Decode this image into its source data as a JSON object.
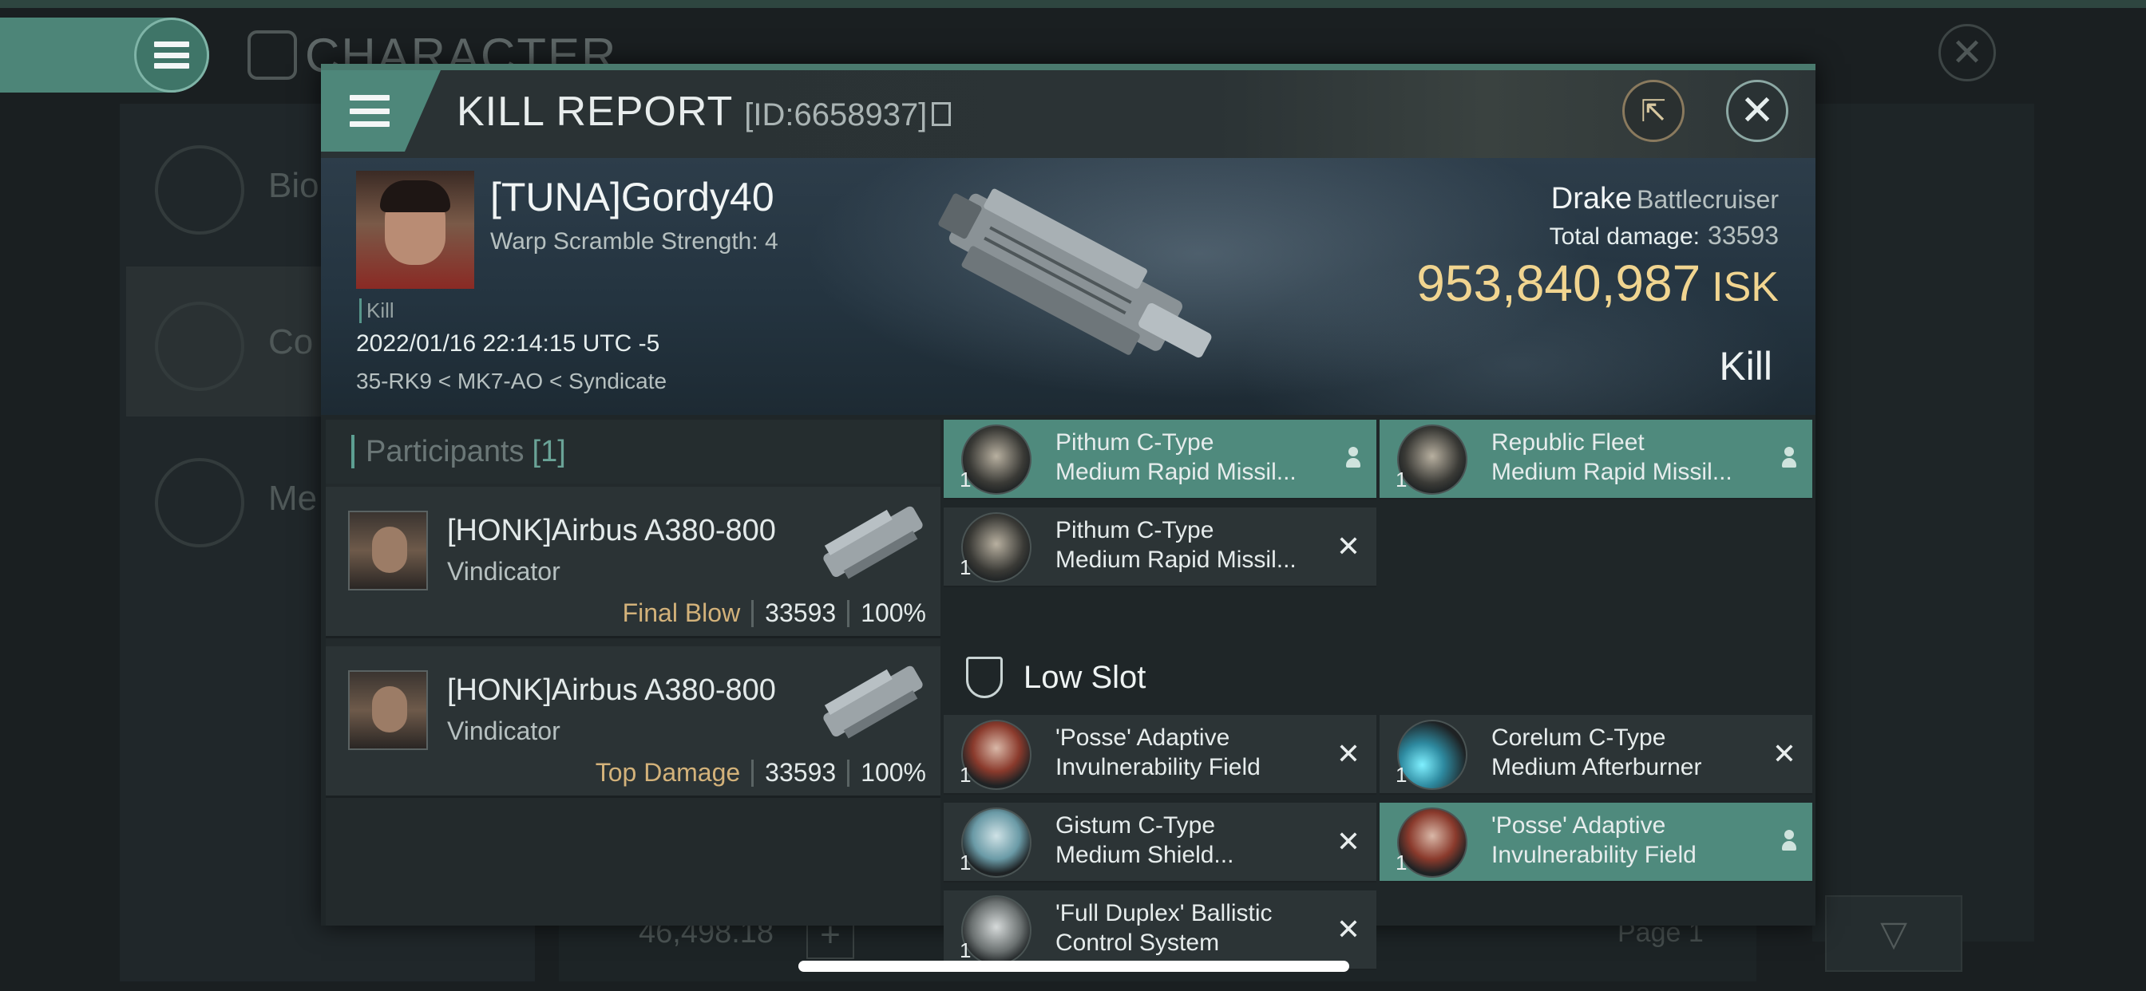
{
  "background": {
    "title": "CHARACTER",
    "tabs": [
      "Bio",
      "Co",
      "Me"
    ],
    "wallet_value": "46,498.18",
    "plus": "+",
    "page_label": "Page 1"
  },
  "kill_report": {
    "title": "KILL REPORT",
    "id_label": "[ID:6658937]",
    "victim": {
      "name": "[TUNA]Gordy40",
      "warp_scramble": "Warp Scramble Strength: 4",
      "kill_flag": "Kill",
      "timestamp": "2022/01/16 22:14:15 UTC -5",
      "location": "35-RK9 < MK7-AO < Syndicate"
    },
    "ship": {
      "name": "Drake",
      "class": "Battlecruiser",
      "total_damage_label": "Total damage:",
      "total_damage": "33593",
      "isk_value": "953,840,987",
      "isk_unit": "ISK",
      "result": "Kill"
    },
    "participants": {
      "label": "Participants",
      "count": "[1]",
      "rows": [
        {
          "name": "[HONK]Airbus A380-800",
          "ship": "Vindicator",
          "tag": "Final Blow",
          "damage": "33593",
          "percent": "100%"
        },
        {
          "name": "[HONK]Airbus A380-800",
          "ship": "Vindicator",
          "tag": "Top Damage",
          "damage": "33593",
          "percent": "100%"
        }
      ]
    },
    "modules": {
      "top": [
        {
          "line1": "Pithum C-Type",
          "line2": "Medium Rapid Missil...",
          "qty": "1",
          "status": "dropped",
          "icon": "launcher"
        },
        {
          "line1": "Republic Fleet",
          "line2": "Medium Rapid Missil...",
          "qty": "1",
          "status": "dropped",
          "icon": "launcher"
        },
        {
          "line1": "Pithum C-Type",
          "line2": "Medium Rapid Missil...",
          "qty": "1",
          "status": "destroyed",
          "icon": "launcher"
        }
      ],
      "low_slot_label": "Low Slot",
      "low": [
        {
          "line1": "'Posse' Adaptive",
          "line2": "Invulnerability Field",
          "qty": "1",
          "status": "destroyed",
          "icon": "shield-red"
        },
        {
          "line1": "Corelum C-Type",
          "line2": "Medium Afterburner",
          "qty": "1",
          "status": "destroyed",
          "icon": "afterburner"
        },
        {
          "line1": "Gistum C-Type",
          "line2": "Medium Shield...",
          "qty": "1",
          "status": "destroyed",
          "icon": "shield-blue"
        },
        {
          "line1": "'Posse' Adaptive",
          "line2": "Invulnerability Field",
          "qty": "1",
          "status": "dropped",
          "icon": "shield-red"
        },
        {
          "line1": "'Full Duplex' Ballistic",
          "line2": "Control System",
          "qty": "1",
          "status": "destroyed",
          "icon": "ballistic"
        }
      ],
      "destroyed_symbol": "✕"
    },
    "colors": {
      "accent": "#4f8a7d",
      "isk": "#f1d590",
      "final_blow": "#d3b27a"
    }
  }
}
